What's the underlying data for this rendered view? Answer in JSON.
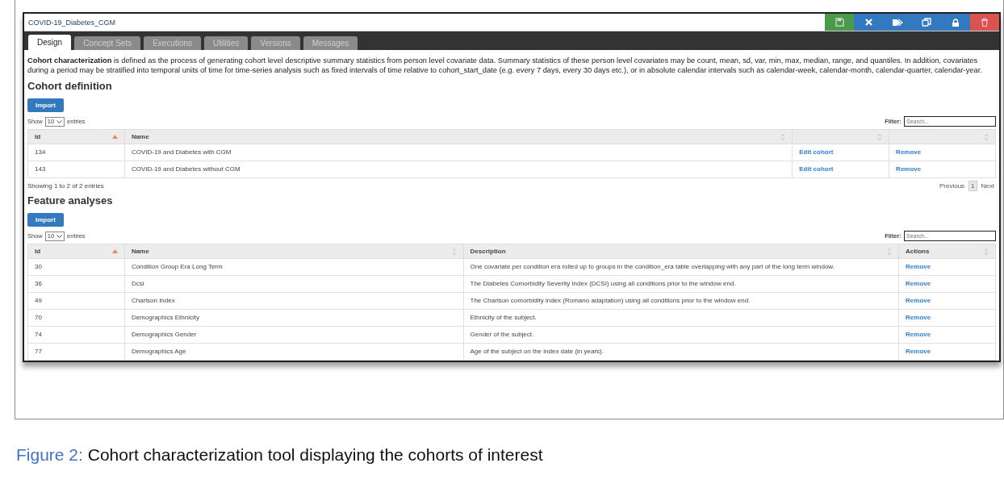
{
  "window": {
    "title": "COVID-19_Diabetes_CGM"
  },
  "toolbar": [
    {
      "kind": "save"
    },
    {
      "kind": "close"
    },
    {
      "kind": "tags"
    },
    {
      "kind": "copy"
    },
    {
      "kind": "lock"
    },
    {
      "kind": "delete"
    }
  ],
  "tabs": [
    {
      "label": "Design",
      "selected": true
    },
    {
      "label": "Concept Sets",
      "selected": false
    },
    {
      "label": "Executions",
      "selected": false
    },
    {
      "label": "Utilities",
      "selected": false
    },
    {
      "label": "Versions",
      "selected": false
    },
    {
      "label": "Messages",
      "selected": false
    }
  ],
  "intro": "**Cohort characterization** is defined as the process of generating cohort level descriptive summary statistics from person level covariate data. Summary statistics of these person level covariates may be count, mean, sd, var, min, max, median, range, and quantiles. In addition, covariates during a period may be stratified into temporal units of time for time-series analysis such as fixed intervals of time relative to cohort_start_date (e.g. every 7 days, every 30 days etc.), or in absolute calendar intervals such as calendar-week, calendar-month, calendar-quarter, calendar-year.",
  "sections": [
    {
      "heading": "Cohort definition",
      "import_button": "Import",
      "show_label": "Show",
      "page_size": "10",
      "entries_label": "entries",
      "filter_label": "Filter:",
      "filter_placeholder": "Search...",
      "columns": [
        {
          "label": "Id",
          "sorted": true,
          "kind": "text"
        },
        {
          "label": "Name",
          "sorted": false,
          "kind": "text"
        },
        {
          "sorted": false,
          "kind": "link"
        },
        {
          "sorted": false,
          "kind": "link"
        }
      ],
      "rows": [
        [
          "134",
          "COVID-19 and Diabetes with CGM",
          "Edit cohort",
          "Remove"
        ],
        [
          "143",
          "COVID-19 and Diabetes without CGM",
          "Edit cohort",
          "Remove"
        ]
      ],
      "info": "Showing 1 to 2 of 2 entries",
      "pagination": [
        {
          "label": "Previous",
          "selected": false
        },
        {
          "label": "1",
          "selected": true
        },
        {
          "label": "Next",
          "selected": false
        }
      ]
    },
    {
      "heading": "Feature analyses",
      "import_button": "Import",
      "show_label": "Show",
      "page_size": "10",
      "entries_label": "entries",
      "filter_label": "Filter:",
      "filter_placeholder": "Search...",
      "columns": [
        {
          "label": "Id",
          "sorted": true,
          "kind": "text"
        },
        {
          "label": "Name",
          "sorted": false,
          "kind": "text"
        },
        {
          "label": "Description",
          "sorted": false,
          "kind": "text"
        },
        {
          "label": "Actions",
          "sorted": false,
          "kind": "link"
        }
      ],
      "rows": [
        [
          "30",
          "Condition Group Era Long Term",
          "One covariate per condition era rolled up to groups in the condition_era table overlapping with any part of the long term window.",
          "Remove"
        ],
        [
          "36",
          "Dcsi",
          "The Diabetes Comorbidity Severity Index (DCSI) using all conditions prior to the window end.",
          "Remove"
        ],
        [
          "49",
          "Charlson Index",
          "The Charlson comorbidity index (Romano adaptation) using all conditions prior to the window end.",
          "Remove"
        ],
        [
          "70",
          "Demographics Ethnicity",
          "Ethnicity of the subject.",
          "Remove"
        ],
        [
          "74",
          "Demographics Gender",
          "Gender of the subject.",
          "Remove"
        ],
        [
          "77",
          "Demographics Age",
          "Age of the subject on the index date (in years).",
          "Remove"
        ]
      ]
    }
  ],
  "caption": {
    "label": "Figure 2:",
    "text": "Cohort characterization tool displaying the cohorts of interest"
  }
}
